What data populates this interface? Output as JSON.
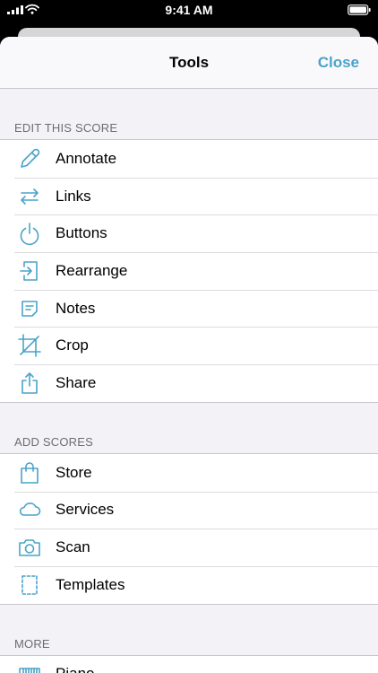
{
  "status_bar": {
    "time": "9:41 AM"
  },
  "navbar": {
    "title": "Tools",
    "close_label": "Close"
  },
  "sections": [
    {
      "header": "EDIT THIS SCORE",
      "items": [
        {
          "label": "Annotate",
          "icon": "pencil-icon"
        },
        {
          "label": "Links",
          "icon": "arrows-icon"
        },
        {
          "label": "Buttons",
          "icon": "tap-button-icon"
        },
        {
          "label": "Rearrange",
          "icon": "rearrange-icon"
        },
        {
          "label": "Notes",
          "icon": "notes-icon"
        },
        {
          "label": "Crop",
          "icon": "crop-icon"
        },
        {
          "label": "Share",
          "icon": "share-icon"
        }
      ]
    },
    {
      "header": "ADD SCORES",
      "items": [
        {
          "label": "Store",
          "icon": "shopping-bag-icon"
        },
        {
          "label": "Services",
          "icon": "cloud-icon"
        },
        {
          "label": "Scan",
          "icon": "camera-icon"
        },
        {
          "label": "Templates",
          "icon": "template-icon"
        }
      ]
    },
    {
      "header": "MORE",
      "items": [
        {
          "label": "Piano",
          "icon": "piano-icon"
        }
      ]
    }
  ],
  "colors": {
    "accent": "#4aa3c9",
    "background": "#f2f2f7",
    "separator": "#c8c7cc"
  }
}
